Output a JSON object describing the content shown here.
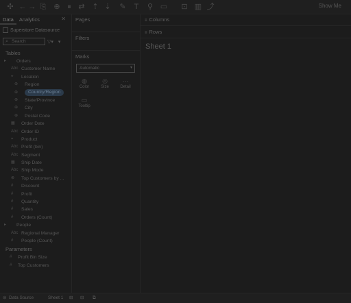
{
  "toolbar": {
    "icons": [
      "tableau-logo-icon",
      "back-icon",
      "forward-icon",
      "save-icon",
      "new-datasource-icon",
      "pause-icon",
      "swap-icon",
      "sort-asc-icon",
      "sort-desc-icon",
      "highlight-icon",
      "label-icon",
      "format-icon",
      "fit-icon",
      "present-icon",
      "chart-icon",
      "share-icon"
    ],
    "show_me": "Show Me"
  },
  "left": {
    "tabs": [
      "Data",
      "Analytics"
    ],
    "close": "✕",
    "datasource": "Superstore Datasource",
    "search_placeholder": "Search",
    "tables_heading": "Tables",
    "fields": [
      {
        "icon": "▸",
        "label": "Orders",
        "indent": 0
      },
      {
        "icon": "Abc",
        "label": "Customer Name",
        "indent": 1
      },
      {
        "icon": "⌖",
        "label": "Location",
        "indent": 1
      },
      {
        "icon": "⊕",
        "label": "Region",
        "indent": 2
      },
      {
        "icon": "⊕",
        "label": "Country/Region",
        "indent": 2
      },
      {
        "icon": "⊕",
        "label": "State/Province",
        "indent": 2
      },
      {
        "icon": "⊕",
        "label": "City",
        "indent": 2
      },
      {
        "icon": "⊕",
        "label": "Postal Code",
        "indent": 2
      },
      {
        "icon": "▦",
        "label": "Order Date",
        "indent": 1
      },
      {
        "icon": "Abc",
        "label": "Order ID",
        "indent": 1
      },
      {
        "icon": "⌖",
        "label": "Product",
        "indent": 1
      },
      {
        "icon": "Abc",
        "label": "Profit (bin)",
        "indent": 1
      },
      {
        "icon": "Abc",
        "label": "Segment",
        "indent": 1
      },
      {
        "icon": "▦",
        "label": "Ship Date",
        "indent": 1
      },
      {
        "icon": "Abc",
        "label": "Ship Mode",
        "indent": 1
      },
      {
        "icon": "⊗",
        "label": "Top Customers by ...",
        "indent": 1
      },
      {
        "icon": "#",
        "label": "Discount",
        "indent": 1
      },
      {
        "icon": "#",
        "label": "Profit",
        "indent": 1
      },
      {
        "icon": "#",
        "label": "Quantity",
        "indent": 1
      },
      {
        "icon": "#",
        "label": "Sales",
        "indent": 1
      },
      {
        "icon": "#",
        "label": "Orders (Count)",
        "indent": 1
      },
      {
        "icon": "▸",
        "label": "People",
        "indent": 0
      },
      {
        "icon": "Abc",
        "label": "Regional Manager",
        "indent": 1
      },
      {
        "icon": "#",
        "label": "People (Count)",
        "indent": 1
      }
    ],
    "selected_index": 4,
    "parameters_heading": "Parameters",
    "parameters": [
      {
        "icon": "#",
        "label": "Profit Bin Size"
      },
      {
        "icon": "#",
        "label": "Top Customers"
      }
    ]
  },
  "mid": {
    "pages": "Pages",
    "filters": "Filters",
    "marks": "Marks",
    "marks_type": "Automatic",
    "mark_buttons": [
      {
        "icon": "◍",
        "label": "Color"
      },
      {
        "icon": "◎",
        "label": "Size"
      },
      {
        "icon": "⋯",
        "label": "Detail"
      },
      {
        "icon": "▭",
        "label": "Tooltip"
      }
    ]
  },
  "shelves": {
    "columns": "Columns",
    "rows": "Rows",
    "sheet_title": "Sheet 1"
  },
  "status": {
    "datasource": "Data Source",
    "sheet": "Sheet 1"
  }
}
